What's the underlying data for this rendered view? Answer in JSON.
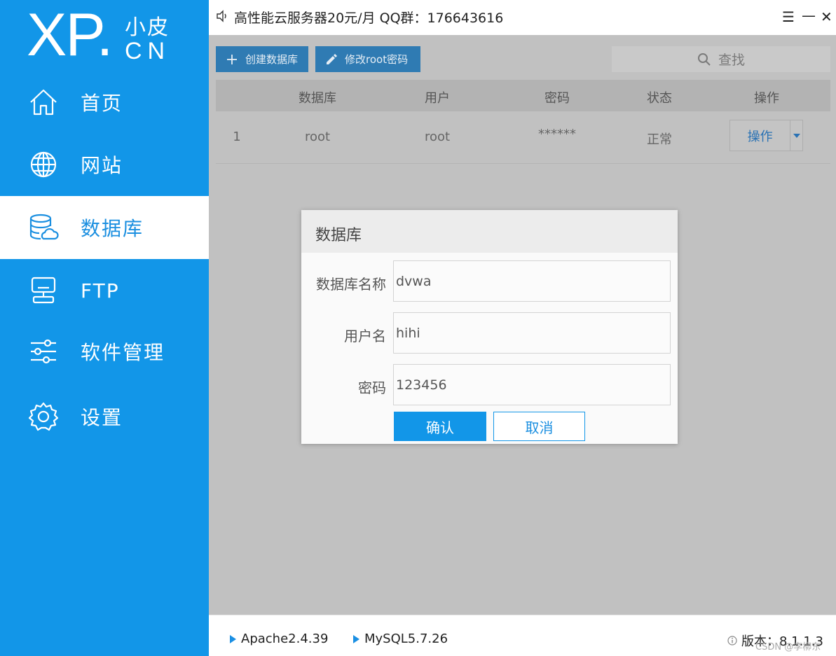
{
  "logo": {
    "brand": "XP",
    "dot": ".",
    "name_cn": "小皮",
    "suffix": "CN"
  },
  "sidebar": {
    "items": [
      {
        "label": "首页",
        "icon": "home-icon",
        "active": false
      },
      {
        "label": "网站",
        "icon": "globe-icon",
        "active": false
      },
      {
        "label": "数据库",
        "icon": "database-icon",
        "active": true
      },
      {
        "label": "FTP",
        "icon": "server-icon",
        "active": false
      },
      {
        "label": "软件管理",
        "icon": "sliders-icon",
        "active": false
      },
      {
        "label": "设置",
        "icon": "gear-icon",
        "active": false
      }
    ]
  },
  "topbar": {
    "notice": "高性能云服务器20元/月  QQ群：176643616",
    "menu_icon": "☰",
    "minimize_icon": "—",
    "close_icon": "✕"
  },
  "toolbar": {
    "create_label": "创建数据库",
    "edit_root_label": "修改root密码",
    "search_label": "查找"
  },
  "table": {
    "headers": [
      "数据库",
      "用户",
      "密码",
      "状态",
      "操作"
    ],
    "rows": [
      {
        "index": "1",
        "database": "root",
        "user": "root",
        "password": "******",
        "status": "正常",
        "action": "操作"
      }
    ]
  },
  "dialog": {
    "title": "数据库",
    "fields": [
      {
        "label": "数据库名称",
        "value": "dvwa"
      },
      {
        "label": "用户名",
        "value": "hihi"
      },
      {
        "label": "密码",
        "value": "123456"
      }
    ],
    "confirm_label": "确认",
    "cancel_label": "取消"
  },
  "statusbar": {
    "apache": "Apache2.4.39",
    "mysql": "MySQL5.7.26",
    "version": "版本：8.1.1.3",
    "watermark": "CSDN @李柳东"
  },
  "colors": {
    "accent": "#1296e8",
    "sidebar_bg": "#1296e8",
    "toolbar_btn": "#2f7bb3"
  }
}
